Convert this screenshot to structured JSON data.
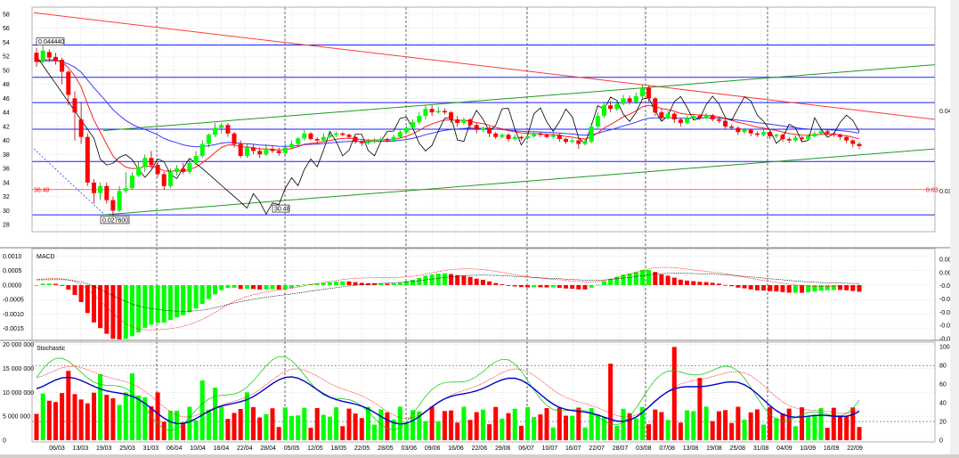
{
  "colors": {
    "up": "#00ff00",
    "down": "#ff0000",
    "grid": "#c8c8c8",
    "blue_level": "#1d1dff",
    "trend_green": "#1f9a1f",
    "trend_red": "#ff3b3b",
    "ma_blue": "#3a3aff",
    "ma_red": "#ff2020",
    "overlay": "#000000",
    "stoch_k": "#0000c8"
  },
  "chart_data": [
    {
      "type": "line",
      "panel": "price",
      "y_ticks": [
        "58",
        "56",
        "54",
        "52",
        "50",
        "48",
        "46",
        "44",
        "42",
        "40",
        "38",
        "36",
        "34",
        "32",
        "30",
        "28"
      ],
      "right_ticks": [
        "0.04",
        "0.03"
      ],
      "ylim": [
        27,
        59
      ],
      "date_labels": [
        "06/03",
        "13/03",
        "19/03",
        "25/03",
        "31/03",
        "06/04",
        "10/04",
        "16/04",
        "22/04",
        "28/04",
        "05/05",
        "12/05",
        "18/05",
        "22/05",
        "28/05",
        "03/06",
        "09/06",
        "16/06",
        "22/06",
        "29/06",
        "06/07",
        "10/07",
        "16/07",
        "22/07",
        "28/07",
        "03/08",
        "07/08",
        "13/08",
        "19/08",
        "25/08",
        "31/08",
        "04/09",
        "10/09",
        "16/09",
        "22/09"
      ],
      "candles": [
        [
          52.5,
          51.2,
          53.2,
          50.5
        ],
        [
          51.3,
          52.8,
          53.5,
          51.0
        ],
        [
          52.6,
          51.8,
          53.0,
          51.2
        ],
        [
          51.9,
          51.3,
          52.5,
          50.8
        ],
        [
          51.5,
          49.8,
          51.8,
          48.0
        ],
        [
          49.8,
          46.5,
          50.0,
          45.0
        ],
        [
          46.0,
          44.0,
          47.0,
          40.0
        ],
        [
          43.0,
          40.5,
          45.5,
          39.5
        ],
        [
          40.5,
          34.0,
          41.0,
          33.5
        ],
        [
          34.0,
          32.5,
          34.5,
          31.0
        ],
        [
          32.5,
          33.5,
          34.0,
          31.5
        ],
        [
          33.5,
          31.5,
          34.0,
          31.0
        ],
        [
          31.5,
          30.0,
          32.0,
          29.2
        ],
        [
          30.0,
          32.8,
          33.5,
          29.8
        ],
        [
          32.8,
          33.2,
          35.5,
          32.5
        ],
        [
          33.2,
          35.0,
          35.5,
          33.0
        ],
        [
          35.0,
          36.2,
          37.0,
          34.8
        ],
        [
          36.2,
          37.5,
          38.0,
          35.5
        ],
        [
          37.5,
          36.5,
          38.5,
          36.0
        ],
        [
          36.5,
          35.2,
          37.0,
          34.8
        ],
        [
          35.2,
          33.5,
          35.5,
          33.0
        ],
        [
          33.5,
          35.5,
          36.0,
          33.2
        ],
        [
          35.5,
          36.0,
          36.5,
          35.0
        ],
        [
          36.0,
          35.5,
          36.8,
          35.2
        ],
        [
          35.5,
          36.8,
          37.5,
          35.2
        ],
        [
          36.8,
          37.8,
          38.5,
          36.5
        ],
        [
          37.8,
          39.5,
          40.0,
          37.5
        ],
        [
          39.5,
          40.8,
          41.0,
          39.0
        ],
        [
          40.8,
          41.8,
          42.5,
          40.5
        ],
        [
          41.8,
          42.2,
          42.5,
          41.0
        ],
        [
          42.2,
          41.0,
          42.5,
          40.5
        ],
        [
          41.0,
          39.5,
          41.2,
          39.0
        ],
        [
          39.5,
          37.8,
          40.0,
          37.5
        ],
        [
          37.8,
          39.0,
          39.5,
          37.5
        ],
        [
          39.0,
          38.5,
          39.5,
          38.0
        ],
        [
          38.5,
          38.0,
          39.0,
          37.5
        ],
        [
          38.0,
          38.8,
          39.5,
          37.8
        ],
        [
          38.8,
          38.5,
          39.2,
          38.2
        ],
        [
          38.5,
          38.2,
          39.0,
          37.8
        ],
        [
          38.2,
          39.0,
          39.5,
          38.0
        ],
        [
          39.0,
          39.5,
          40.0,
          38.8
        ],
        [
          39.5,
          40.3,
          40.5,
          39.2
        ],
        [
          40.3,
          41.0,
          41.5,
          40.0
        ],
        [
          41.0,
          40.2,
          41.2,
          40.0
        ],
        [
          40.2,
          40.0,
          40.5,
          39.5
        ],
        [
          40.0,
          40.5,
          41.0,
          39.8
        ],
        [
          40.5,
          40.8,
          41.2,
          40.3
        ],
        [
          40.8,
          41.0,
          41.3,
          40.5
        ],
        [
          41.0,
          40.8,
          41.2,
          40.6
        ],
        [
          40.8,
          40.5,
          41.0,
          40.2
        ],
        [
          40.5,
          39.8,
          40.6,
          39.5
        ],
        [
          39.8,
          39.6,
          40.0,
          39.2
        ],
        [
          39.6,
          39.8,
          40.2,
          39.4
        ],
        [
          39.8,
          40.0,
          40.3,
          39.6
        ],
        [
          40.0,
          40.2,
          40.5,
          39.8
        ],
        [
          40.2,
          40.0,
          40.4,
          39.7
        ],
        [
          40.0,
          40.5,
          40.8,
          39.8
        ],
        [
          40.5,
          41.2,
          41.5,
          40.3
        ],
        [
          41.2,
          41.8,
          42.0,
          41.0
        ],
        [
          41.8,
          42.6,
          43.0,
          41.5
        ],
        [
          42.6,
          43.5,
          44.0,
          42.3
        ],
        [
          43.5,
          44.5,
          45.0,
          43.0
        ],
        [
          44.5,
          44.0,
          45.0,
          43.5
        ],
        [
          44.0,
          44.2,
          44.8,
          43.8
        ],
        [
          44.2,
          44.0,
          44.6,
          43.7
        ],
        [
          44.0,
          43.0,
          44.2,
          42.5
        ],
        [
          43.0,
          42.5,
          43.5,
          42.0
        ],
        [
          42.5,
          43.0,
          43.3,
          42.2
        ],
        [
          43.0,
          42.2,
          43.2,
          41.8
        ],
        [
          42.2,
          41.5,
          42.5,
          41.0
        ],
        [
          41.5,
          41.8,
          42.0,
          41.2
        ],
        [
          41.8,
          41.0,
          42.0,
          40.5
        ],
        [
          41.0,
          40.5,
          41.2,
          40.2
        ],
        [
          40.5,
          40.8,
          41.0,
          40.3
        ],
        [
          40.8,
          40.2,
          41.0,
          39.8
        ],
        [
          40.2,
          40.5,
          40.8,
          40.0
        ],
        [
          40.5,
          40.3,
          40.7,
          40.0
        ],
        [
          40.3,
          40.6,
          40.9,
          40.1
        ],
        [
          40.6,
          41.0,
          41.2,
          40.4
        ],
        [
          41.0,
          40.8,
          41.2,
          40.5
        ],
        [
          40.8,
          40.5,
          41.0,
          40.3
        ],
        [
          40.5,
          40.8,
          41.0,
          40.3
        ],
        [
          40.8,
          40.2,
          41.0,
          39.8
        ],
        [
          40.2,
          39.8,
          40.4,
          39.5
        ],
        [
          39.8,
          40.0,
          40.3,
          39.6
        ],
        [
          40.0,
          39.5,
          40.2,
          38.8
        ],
        [
          39.5,
          39.8,
          40.2,
          39.3
        ],
        [
          39.8,
          42.0,
          42.5,
          39.6
        ],
        [
          42.0,
          43.5,
          44.0,
          41.8
        ],
        [
          43.5,
          45.0,
          45.5,
          43.2
        ],
        [
          45.0,
          44.5,
          45.6,
          44.0
        ],
        [
          44.5,
          45.2,
          45.8,
          44.2
        ],
        [
          45.2,
          46.0,
          46.5,
          45.0
        ],
        [
          46.0,
          45.5,
          46.4,
          45.1
        ],
        [
          45.5,
          46.3,
          46.8,
          45.2
        ],
        [
          46.3,
          47.5,
          48.0,
          46.0
        ],
        [
          47.5,
          46.0,
          47.8,
          45.5
        ],
        [
          46.0,
          44.0,
          46.2,
          43.5
        ],
        [
          44.0,
          43.2,
          44.5,
          42.8
        ],
        [
          43.2,
          43.8,
          44.2,
          43.0
        ],
        [
          43.8,
          43.0,
          44.0,
          42.5
        ],
        [
          43.0,
          42.5,
          43.2,
          42.0
        ],
        [
          42.5,
          43.2,
          43.5,
          42.3
        ],
        [
          43.2,
          43.5,
          43.8,
          43.0
        ],
        [
          43.5,
          43.2,
          43.8,
          42.9
        ],
        [
          43.2,
          43.6,
          43.9,
          43.0
        ],
        [
          43.6,
          43.0,
          43.8,
          42.7
        ],
        [
          43.0,
          42.8,
          43.3,
          42.5
        ],
        [
          42.8,
          42.0,
          43.0,
          41.7
        ],
        [
          42.0,
          41.8,
          42.3,
          41.5
        ],
        [
          41.8,
          41.2,
          42.0,
          40.8
        ],
        [
          41.2,
          41.5,
          41.8,
          40.9
        ],
        [
          41.5,
          41.0,
          41.7,
          40.6
        ],
        [
          41.0,
          40.8,
          41.3,
          40.5
        ],
        [
          40.8,
          41.2,
          41.5,
          40.6
        ],
        [
          41.2,
          40.6,
          41.4,
          40.2
        ],
        [
          40.6,
          40.8,
          41.0,
          40.3
        ],
        [
          40.8,
          40.2,
          41.0,
          39.8
        ],
        [
          40.2,
          40.0,
          40.5,
          39.6
        ],
        [
          40.0,
          40.4,
          40.7,
          39.8
        ],
        [
          40.4,
          40.2,
          40.6,
          39.9
        ],
        [
          40.2,
          40.6,
          40.9,
          40.0
        ],
        [
          40.6,
          41.0,
          41.3,
          40.4
        ],
        [
          41.0,
          41.3,
          41.6,
          40.8
        ],
        [
          41.3,
          41.0,
          41.5,
          40.7
        ],
        [
          41.0,
          40.8,
          41.2,
          40.5
        ],
        [
          40.8,
          40.5,
          41.0,
          40.1
        ],
        [
          40.5,
          40.0,
          40.7,
          39.6
        ],
        [
          40.0,
          39.5,
          40.2,
          39.0
        ],
        [
          39.5,
          39.2,
          39.8,
          38.8
        ]
      ],
      "blue_levels": [
        53.6,
        49.0,
        45.4,
        41.6,
        37.0,
        29.4
      ],
      "red_level": 33.0,
      "left_value_label": "38.48",
      "right_value_label": "0.03",
      "annotations": [
        {
          "text": "0.044440",
          "at": "high"
        },
        {
          "text": "0.027600",
          "at": "low"
        },
        {
          "text": "30.48",
          "at": "overlay-low"
        }
      ]
    },
    {
      "type": "bar",
      "panel": "macd",
      "title": "MACD",
      "y_ticks": [
        "0.0010",
        "0.0005",
        "0.0000",
        "-0.0005",
        "-0.0010",
        "-0.0015"
      ],
      "right_ticks": [
        "0.001",
        "0.000",
        "-0.001",
        "-0.002",
        "-0.003",
        "-0.004",
        "-0.005"
      ],
      "ylim": [
        -0.00185,
        0.0012
      ]
    },
    {
      "type": "bar",
      "panel": "volume",
      "title": "Stochastic",
      "y_ticks": [
        "20 000 000",
        "15 000 000",
        "10 000 000",
        "5 000 000",
        "0"
      ],
      "right_ticks": [
        "100",
        "80",
        "60",
        "40",
        "20",
        "0"
      ],
      "ylim": [
        0,
        20500000
      ]
    }
  ]
}
